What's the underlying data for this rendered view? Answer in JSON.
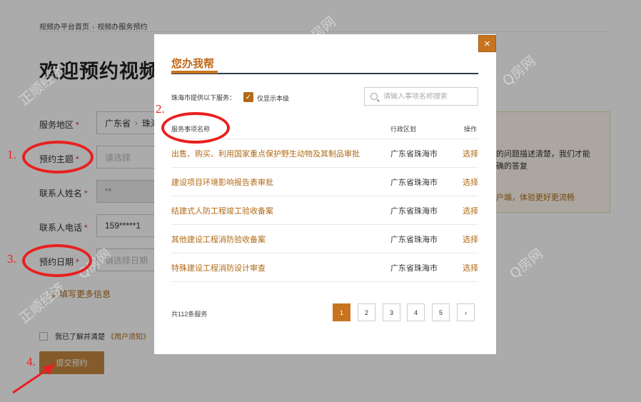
{
  "breadcrumb": {
    "home": "视频办平台首页",
    "current": "视频办服务预约"
  },
  "page": {
    "welcome": "欢迎预约视频"
  },
  "form": {
    "region_label": "服务地区",
    "region_province": "广东省",
    "region_city": "珠海",
    "topic_label": "预约主题",
    "topic_placeholder": "请选择",
    "name_label": "联系人姓名",
    "name_value": "**",
    "phone_label": "联系人电话",
    "phone_value": "159*****1",
    "date_label": "预约日期",
    "date_placeholder": "请选择日期",
    "required_mark": "*",
    "more_info": "填写更多信息",
    "agree_text": "我已了解并清楚",
    "agree_link": "《用户须知》",
    "submit": "提交预约"
  },
  "tips": {
    "line1": "的问题描述清楚，我们才能",
    "line2": "确的答复",
    "line3": "户端，体验更好更流畅"
  },
  "modal": {
    "title": "您办我帮",
    "close": "×",
    "filter_label": "珠海市提供以下服务：",
    "filter_checkbox": "仅显示本级",
    "search_placeholder": "请输入事项名称搜索",
    "columns": [
      "服务事项名称",
      "行政区划",
      "操作"
    ],
    "rows": [
      {
        "name": "出售、购买、利用国家重点保护野生动物及其制品审批",
        "region": "广东省珠海市",
        "op": "选择"
      },
      {
        "name": "建设项目环境影响报告表审批",
        "region": "广东省珠海市",
        "op": "选择"
      },
      {
        "name": "结建式人防工程竣工验收备案",
        "region": "广东省珠海市",
        "op": "选择"
      },
      {
        "name": "其他建设工程消防验收备案",
        "region": "广东省珠海市",
        "op": "选择"
      },
      {
        "name": "特殊建设工程消防设计审查",
        "region": "广东省珠海市",
        "op": "选择"
      }
    ],
    "total": "共112条服务",
    "pages": [
      "1",
      "2",
      "3",
      "4",
      "5"
    ],
    "next": "›",
    "active_page": 1
  },
  "annotations": {
    "n1": "1.",
    "n2": "2.",
    "n3": "3.",
    "n4": "4."
  },
  "watermarks": {
    "a": "正顺经济",
    "b": "Q房网"
  },
  "colors": {
    "accent": "#c8741e",
    "annotation": "#e8201f",
    "overlay": "rgba(0,0,0,0.33)"
  }
}
